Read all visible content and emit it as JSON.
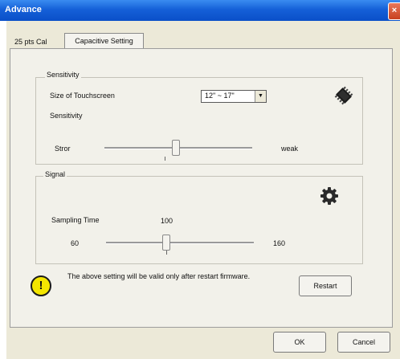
{
  "window": {
    "title": "Advance",
    "close_glyph": "×"
  },
  "tabs": [
    {
      "label": "25 pts Cal",
      "active": false
    },
    {
      "label": "Capacitive Setting",
      "active": true
    }
  ],
  "sensitivity": {
    "group_label": "Sensitivity",
    "size_label": "Size of Touchscreen",
    "size_value": "12\" ~ 17\"",
    "sens_label": "Sensitivity",
    "left_label": "Stror",
    "right_label": "weak",
    "slider_level": 0.48,
    "icon": "chip-icon"
  },
  "signal": {
    "group_label": "Signal",
    "sampling_label": "Sampling Time",
    "current_value": "100",
    "min_label": "60",
    "max_label": "160",
    "slider_level": 0.4,
    "icon": "gear-icon"
  },
  "notice": {
    "text": "The above setting will be valid only after restart firmware.",
    "icon": "warning-icon"
  },
  "buttons": {
    "restart": "Restart",
    "ok": "OK",
    "cancel": "Cancel"
  }
}
